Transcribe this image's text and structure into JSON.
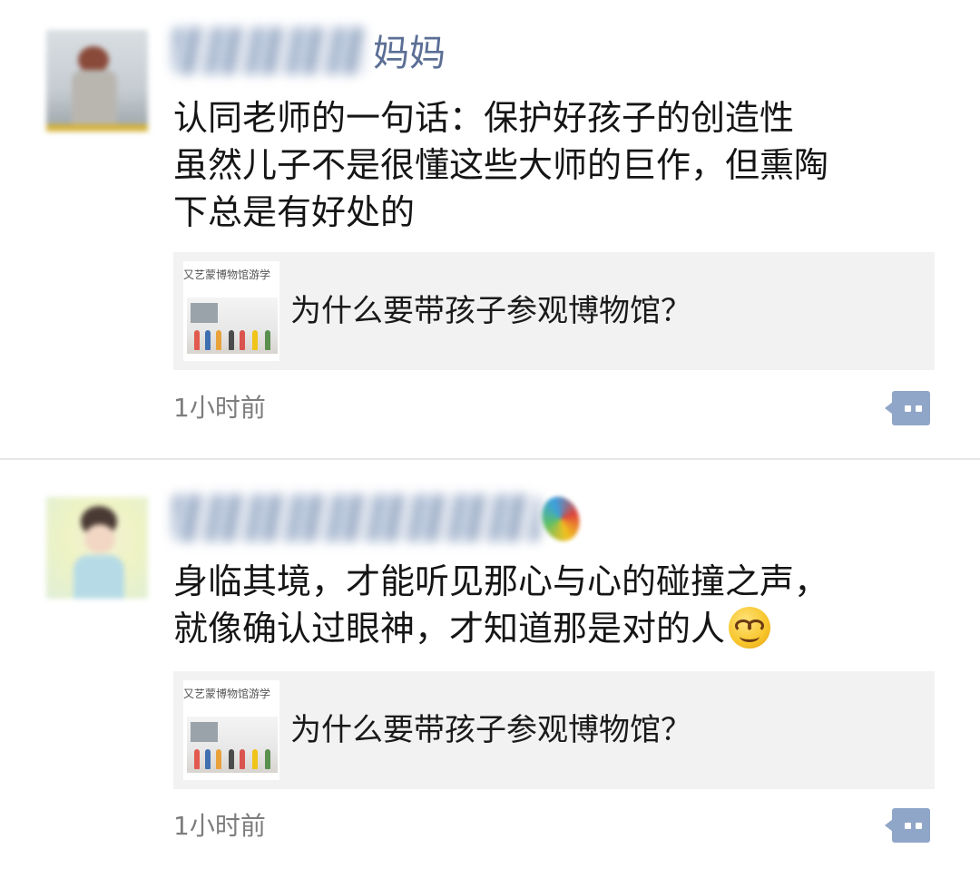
{
  "posts": [
    {
      "author_suffix": "妈妈",
      "body_lines": [
        "认同老师的一句话：保护好孩子的创造性",
        "虽然儿子不是很懂这些大师的巨作，但熏陶",
        "下总是有好处的"
      ],
      "link_card": {
        "thumbnail_caption": "又艺蒙博物馆游学",
        "title": "为什么要带孩子参观博物馆？"
      },
      "timestamp": "1小时前"
    },
    {
      "author_suffix": "",
      "body_lines": [
        "身临其境，才能听见那心与心的碰撞之声，",
        "就像确认过眼神，才知道那是对的人"
      ],
      "emoji": "smirk-face-emoji",
      "link_card": {
        "thumbnail_caption": "又艺蒙博物馆游学",
        "title": "为什么要带孩子参观博物馆？"
      },
      "timestamp": "1小时前"
    }
  ],
  "colors": {
    "author_name": "#5b6f95",
    "timestamp": "#7d7d7d",
    "card_background": "#f2f2f2",
    "comment_icon": "#8fa6c9"
  },
  "icons": {
    "comment": "comment-bubble-icon"
  }
}
